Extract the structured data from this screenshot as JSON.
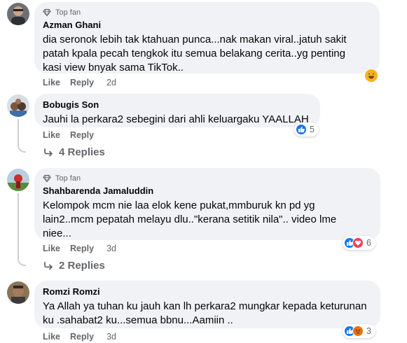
{
  "comments": [
    {
      "badge": "Top fan",
      "author": "Azman Ghani",
      "text": "dia seronok lebih tak ktahuan punca...nak makan viral..jatuh sakit\npatah kpala pecah tengkok itu semua belakang cerita..yg penting\nkasi view bnyak sama TikTok..",
      "like_label": "Like",
      "reply_label": "Reply",
      "time": "2d",
      "reactions": [
        "haha"
      ],
      "reaction_count": ""
    },
    {
      "badge": "",
      "author": "Bobugis Son",
      "text": "Jauhi la perkara2 sebegini dari ahli keluargaku YAALLAH",
      "like_label": "Like",
      "reply_label": "Reply",
      "time": "",
      "reactions": [
        "like"
      ],
      "reaction_count": "5",
      "replies_label": "4 Replies"
    },
    {
      "badge": "Top fan",
      "author": "Shahbarenda Jamaluddin",
      "text": "Kelompok mcm nie laa elok kene pukat,mmburuk kn pd yg\nlain2..mcm pepatah melayu dlu..\"kerana setitik nila\".. video lme\nniee...",
      "like_label": "Like",
      "reply_label": "Reply",
      "time": "3d",
      "reactions": [
        "like",
        "love"
      ],
      "reaction_count": "6",
      "replies_label": "2 Replies"
    },
    {
      "badge": "",
      "author": "Romzi Romzi",
      "text": "Ya Allah ya tuhan ku jauh kan lh perkara2 mungkar kepada keturunan\nku .sahabat2 ku...semua bbnu...Aamiin ..",
      "like_label": "Like",
      "reply_label": "Reply",
      "time": "3d",
      "reactions": [
        "like",
        "angry"
      ],
      "reaction_count": "3"
    }
  ],
  "icons": {
    "badge": "diamond-icon",
    "replies": "reply-arrow-icon",
    "reactions": {
      "like": "#1877f2",
      "love": "#f33e58",
      "haha": "#f7b125",
      "angry": "#e9710f"
    }
  }
}
